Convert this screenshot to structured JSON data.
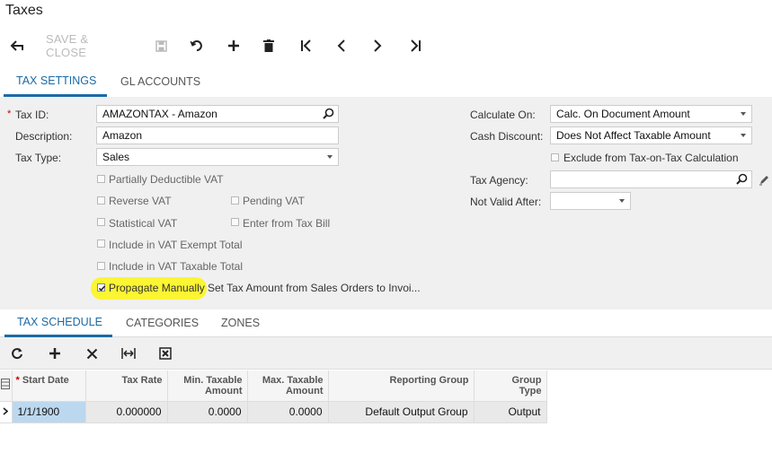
{
  "page": {
    "title": "Taxes"
  },
  "toolbar": {
    "save_close_label": "SAVE & CLOSE"
  },
  "tabs": [
    {
      "label": "TAX SETTINGS",
      "active": true
    },
    {
      "label": "GL ACCOUNTS",
      "active": false
    }
  ],
  "form": {
    "tax_id": {
      "label": "Tax ID:",
      "value": "AMAZONTAX - Amazon"
    },
    "description": {
      "label": "Description:",
      "value": "Amazon"
    },
    "tax_type": {
      "label": "Tax Type:",
      "value": "Sales"
    },
    "calculate_on": {
      "label": "Calculate On:",
      "value": "Calc. On Document Amount"
    },
    "cash_discount": {
      "label": "Cash Discount:",
      "value": "Does Not Affect Taxable Amount"
    },
    "exclude_label": "Exclude from Tax-on-Tax Calculation",
    "tax_agency": {
      "label": "Tax Agency:",
      "value": ""
    },
    "not_valid_after": {
      "label": "Not Valid After:",
      "value": ""
    },
    "checkboxes": {
      "partially_deductible": "Partially Deductible VAT",
      "reverse_vat": "Reverse VAT",
      "pending_vat": "Pending VAT",
      "statistical_vat": "Statistical VAT",
      "enter_from_tax_bill": "Enter from Tax Bill",
      "include_exempt": "Include in VAT Exempt Total",
      "include_taxable": "Include in VAT Taxable Total",
      "propagate_manually": "Propagate Manually",
      "set_tax_amount": "Set Tax Amount from Sales Orders to Invoi..."
    }
  },
  "grid_tabs": [
    {
      "label": "TAX SCHEDULE",
      "active": true
    },
    {
      "label": "CATEGORIES",
      "active": false
    },
    {
      "label": "ZONES",
      "active": false
    }
  ],
  "grid": {
    "columns": [
      "Start Date",
      "Tax Rate",
      "Min. Taxable Amount",
      "Max. Taxable Amount",
      "Reporting Group",
      "Group Type"
    ],
    "col_lines": {
      "min_taxable": [
        "Min. Taxable",
        "Amount"
      ],
      "max_taxable": [
        "Max. Taxable",
        "Amount"
      ],
      "group_type": [
        "Group",
        "Type"
      ]
    },
    "rows": [
      {
        "start_date": "1/1/1900",
        "tax_rate": "0.000000",
        "min_taxable": "0.0000",
        "max_taxable": "0.0000",
        "reporting_group": "Default Output Group",
        "group_type": "Output"
      }
    ]
  },
  "colors": {
    "accent": "#1a6aa6",
    "highlight": "#fbf533",
    "selected_cell": "#bcd8ee"
  }
}
